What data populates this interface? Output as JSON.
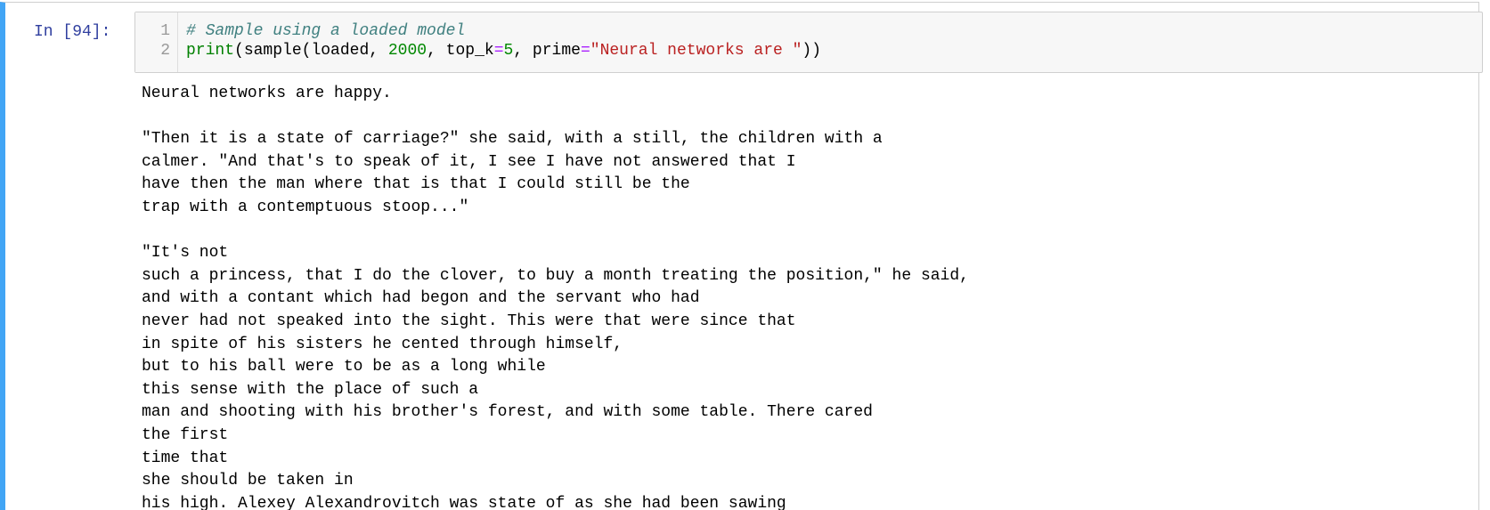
{
  "cell": {
    "prompt": "In [94]:",
    "accent_color": "#42a5f5",
    "code": {
      "line_numbers": [
        "1",
        "2"
      ],
      "line1": {
        "comment": "# Sample using a loaded model"
      },
      "line2": {
        "builtin": "print",
        "open_paren": "(",
        "text1": "sample(loaded, ",
        "number1": "2000",
        "text2": ", top_k",
        "op1": "=",
        "number2": "5",
        "text3": ", prime",
        "op2": "=",
        "string": "\"Neural networks are \"",
        "close": "))"
      }
    },
    "output_lines": [
      "Neural networks are happy.",
      "",
      "\"Then it is a state of carriage?\" she said, with a still, the children with a",
      "calmer. \"And that's to speak of it, I see I have not answered that I",
      "have then the man where that is that I could still be the",
      "trap with a contemptuous stoop...\"",
      "",
      "\"It's not",
      "such a princess, that I do the clover, to buy a month treating the position,\" he said,",
      "and with a contant which had begon and the servant who had",
      "never had not speaked into the sight. This were that were since that",
      "in spite of his sisters he cented through himself,",
      "but to his ball were to be as a long while",
      "this sense with the place of such a",
      "man and shooting with his brother's forest, and with some table. There cared",
      "the first",
      "time that",
      "she should be taken in",
      "his high. Alexey Alexandrovitch was state of as she had been sawing"
    ]
  }
}
